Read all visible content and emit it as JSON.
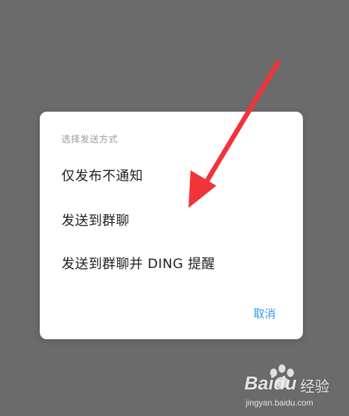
{
  "dialog": {
    "title": "选择发送方式",
    "options": [
      {
        "label": "仅发布不通知"
      },
      {
        "label": "发送到群聊"
      },
      {
        "label": "发送到群聊并 DING 提醒"
      }
    ],
    "cancel_label": "取消"
  },
  "annotation": {
    "arrow_color": "#f0343a"
  },
  "watermark": {
    "brand": "Baidu",
    "brand_cn": "经验",
    "url": "jingyan.baidu.com"
  },
  "colors": {
    "backdrop": "#6b6b6b",
    "accent": "#3296fa"
  }
}
